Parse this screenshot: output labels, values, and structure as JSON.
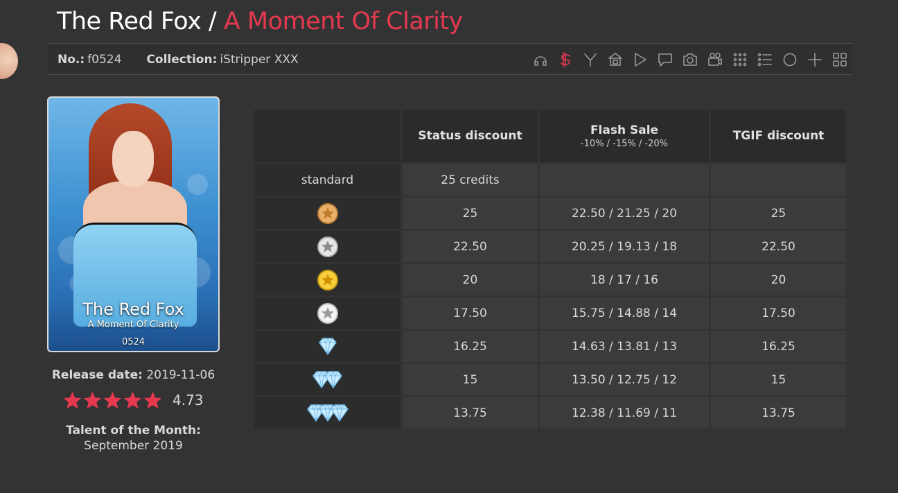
{
  "header": {
    "model_name": "The Red Fox",
    "separator": " / ",
    "show_title": "A Moment Of Clarity"
  },
  "info_bar": {
    "number_label": "No.:",
    "number_value": "f0524",
    "collection_label": "Collection:",
    "collection_value": "iStripper XXX"
  },
  "toolbar": {
    "icons": [
      "headphones-icon",
      "price-icon",
      "filter-icon",
      "lock-icon",
      "play-icon",
      "comment-icon",
      "camera-icon",
      "video-icon",
      "grid-icon",
      "list-icon",
      "circle-icon",
      "plus-icon",
      "collage-icon"
    ],
    "active": "price-icon"
  },
  "card": {
    "name": "The Red Fox",
    "subtitle": "A Moment Of Clarity",
    "code": "0524"
  },
  "release": {
    "label": "Release date:",
    "value": "2019-11-06"
  },
  "rating": {
    "stars": 5,
    "value": "4.73",
    "color": "#e63950"
  },
  "talent_of_month": {
    "label": "Talent of the Month:",
    "value": "September 2019"
  },
  "price_table": {
    "columns": [
      {
        "label": ""
      },
      {
        "label": "Status discount"
      },
      {
        "label": "Flash Sale",
        "sub": "-10% / -15% / -20%"
      },
      {
        "label": "TGIF discount"
      }
    ],
    "rows": [
      {
        "label": "standard",
        "badge": null,
        "status": "25 credits",
        "flash": "",
        "tgif": ""
      },
      {
        "label": "",
        "badge": "bronze-star-icon",
        "status": "25",
        "flash": "22.50 / 21.25 / 20",
        "tgif": "25"
      },
      {
        "label": "",
        "badge": "silver-star-icon",
        "status": "22.50",
        "flash": "20.25 / 19.13 / 18",
        "tgif": "22.50"
      },
      {
        "label": "",
        "badge": "gold-star-icon",
        "status": "20",
        "flash": "18 / 17 / 16",
        "tgif": "20"
      },
      {
        "label": "",
        "badge": "platinum-star-icon",
        "status": "17.50",
        "flash": "15.75 / 14.88 / 14",
        "tgif": "17.50"
      },
      {
        "label": "",
        "badge": "diamond-icon",
        "status": "16.25",
        "flash": "14.63 / 13.81 / 13",
        "tgif": "16.25"
      },
      {
        "label": "",
        "badge": "double-diamond-icon",
        "status": "15",
        "flash": "13.50 / 12.75 / 12",
        "tgif": "15"
      },
      {
        "label": "",
        "badge": "triple-diamond-icon",
        "status": "13.75",
        "flash": "12.38 / 11.69 / 11",
        "tgif": "13.75"
      }
    ]
  },
  "colors": {
    "accent": "#e63950",
    "background": "#333333",
    "bronze": "#e0a45a",
    "silver": "#d4d4d4",
    "gold": "#f2c230",
    "diamond": "#bfe6fb"
  }
}
